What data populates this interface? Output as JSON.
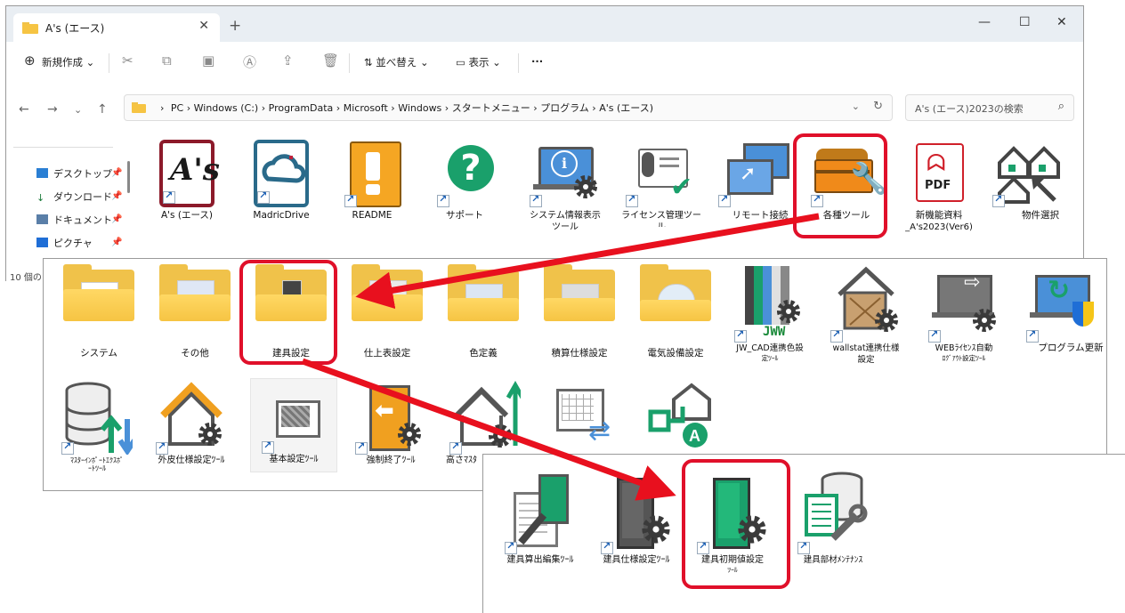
{
  "window": {
    "tab_title": "A's (エース)",
    "toolbar": {
      "new_label": "新規作成",
      "sort_label": "並べ替え",
      "view_label": "表示",
      "more_label": "···"
    },
    "breadcrumb": [
      "PC",
      "Windows (C:)",
      "ProgramData",
      "Microsoft",
      "Windows",
      "スタートメニュー",
      "プログラム",
      "A's (エース)"
    ],
    "search_placeholder": "A's (エース)2023の検索",
    "sidebar": [
      {
        "label": "デスクトップ",
        "icon": "desktop-icon"
      },
      {
        "label": "ダウンロード",
        "icon": "download-icon"
      },
      {
        "label": "ドキュメント",
        "icon": "document-icon"
      },
      {
        "label": "ピクチャ",
        "icon": "pictures-icon"
      }
    ],
    "status": "10 個の"
  },
  "level1_items": [
    {
      "label": "A's (エース)",
      "sub": ""
    },
    {
      "label": "MadricDrive",
      "sub": ""
    },
    {
      "label": "README",
      "sub": ""
    },
    {
      "label": "サポート",
      "sub": ""
    },
    {
      "label": "システム情報表示",
      "sub": "ツール"
    },
    {
      "label": "ライセンス管理ツー",
      "sub": "ル"
    },
    {
      "label": "リモート接続",
      "sub": ""
    },
    {
      "label": "各種ツール",
      "sub": ""
    },
    {
      "label": "新機能資料",
      "sub": "_A's2023(Ver6)"
    },
    {
      "label": "物件選択",
      "sub": ""
    }
  ],
  "level2_items": [
    {
      "label": "システム",
      "sub": ""
    },
    {
      "label": "その他",
      "sub": ""
    },
    {
      "label": "建具設定",
      "sub": ""
    },
    {
      "label": "仕上表設定",
      "sub": ""
    },
    {
      "label": "色定義",
      "sub": ""
    },
    {
      "label": "積算仕様設定",
      "sub": ""
    },
    {
      "label": "電気設備設定",
      "sub": ""
    },
    {
      "label": "JW_CAD連携色設",
      "sub": "定ﾂｰﾙ"
    },
    {
      "label": "wallstat連携仕様",
      "sub": "設定"
    },
    {
      "label": "WEBﾗｲｾﾝｽ自動",
      "sub": "ﾛｸﾞｱｳﾄ設定ﾂｰﾙ"
    },
    {
      "label": "プログラム更新",
      "sub": ""
    },
    {
      "label": "ﾏｽﾀｰｲﾝﾎﾟｰﾄｴｸｽﾎﾟ",
      "sub": "ｰﾄﾂｰﾙ"
    },
    {
      "label": "外皮仕様設定ﾂｰﾙ",
      "sub": ""
    },
    {
      "label": "基本設定ﾂｰﾙ",
      "sub": ""
    },
    {
      "label": "強制終了ﾂｰﾙ",
      "sub": ""
    },
    {
      "label": "高さﾏｽﾀ",
      "sub": ""
    }
  ],
  "level3_items": [
    {
      "label": "建具算出編集ﾂｰﾙ",
      "sub": ""
    },
    {
      "label": "建具仕様設定ﾂｰﾙ",
      "sub": ""
    },
    {
      "label": "建具初期値設定",
      "sub": "ﾂｰﾙ"
    },
    {
      "label": "建具部材ﾒﾝﾃﾅﾝｽ",
      "sub": ""
    }
  ],
  "colors": {
    "highlight": "#e0102a",
    "folder": "#f0c24a",
    "gear": "#3a3a3a",
    "green": "#1aa06b"
  }
}
